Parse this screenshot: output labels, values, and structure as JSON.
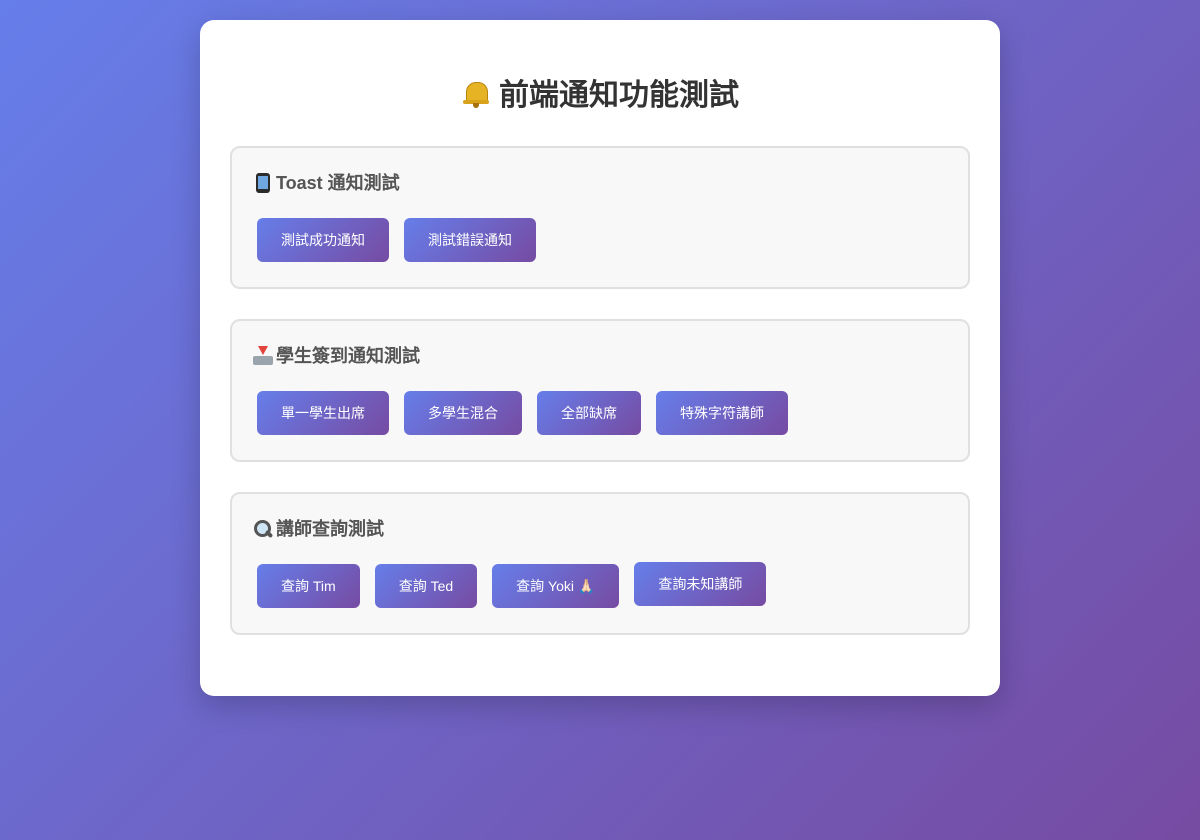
{
  "page": {
    "title": "前端通知功能測試",
    "title_icon": "bell-icon"
  },
  "sections": [
    {
      "icon": "mobile-phone-icon",
      "title": "Toast 通知測試",
      "buttons": [
        "測試成功通知",
        "測試錯誤通知"
      ]
    },
    {
      "icon": "inbox-tray-icon",
      "title": "學生簽到通知測試",
      "buttons": [
        "單一學生出席",
        "多學生混合",
        "全部缺席",
        "特殊字符講師"
      ]
    },
    {
      "icon": "magnifying-glass-icon",
      "title": "講師查詢測試",
      "buttons": [
        "查詢 Tim",
        "查詢 Ted",
        "查詢 Yoki 🙏🏻",
        "查詢未知講師"
      ]
    }
  ],
  "colors": {
    "gradient_start": "#667eea",
    "gradient_end": "#764ba2",
    "card": "#ffffff",
    "section_bg": "#f8f8f8"
  }
}
